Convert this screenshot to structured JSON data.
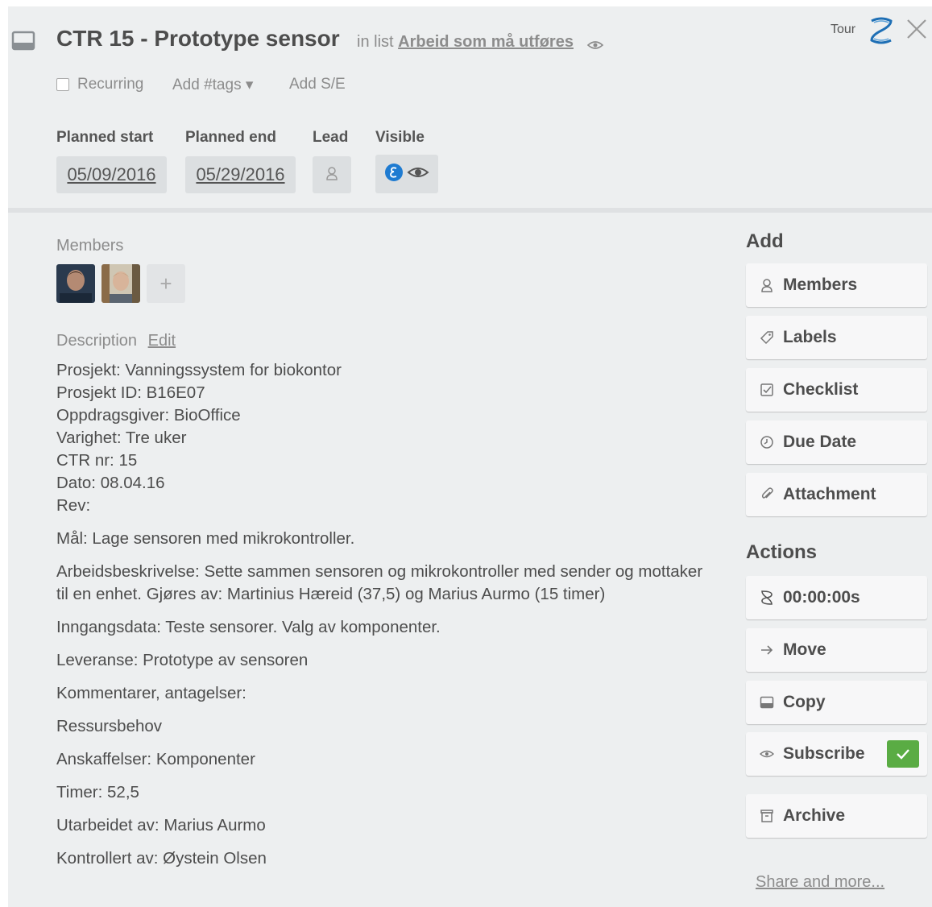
{
  "card": {
    "title": "CTR 15 - Prototype sensor",
    "in_list_prefix": "in list",
    "list_name": "Arbeid som må utføres",
    "tour_label": "Tour"
  },
  "options": {
    "recurring_label": "Recurring",
    "recurring_checked": false,
    "add_tags_label": "Add #tags ▾",
    "add_se_label": "Add S/E"
  },
  "fields": {
    "planned_start_label": "Planned start",
    "planned_start_value": "05/09/2016",
    "planned_end_label": "Planned end",
    "planned_end_value": "05/29/2016",
    "lead_label": "Lead",
    "visible_label": "Visible"
  },
  "members": {
    "label": "Members",
    "add_glyph": "+",
    "count": 2
  },
  "description": {
    "label": "Description",
    "edit_label": "Edit",
    "header_lines": [
      "Prosjekt: Vanningssystem for biokontor",
      "Prosjekt ID: B16E07",
      "Oppdragsgiver: BioOffice",
      "Varighet: Tre uker",
      "CTR nr: 15",
      "Dato: 08.04.16",
      "Rev:"
    ],
    "paragraphs": [
      "Mål: Lage sensoren med mikrokontroller.",
      "Arbeidsbeskrivelse: Sette sammen sensoren og mikrokontroller med sender og mottaker til en enhet. Gjøres av: Martinius Hæreid (37,5) og Marius Aurmo (15 timer)",
      "Inngangsdata: Teste sensorer. Valg av komponenter.",
      "Leveranse: Prototype av sensoren",
      "Kommentarer, antagelser:",
      "Ressursbehov",
      "Anskaffelser: Komponenter",
      "Timer: 52,5",
      "Utarbeidet av: Marius Aurmo",
      "Kontrollert av: Øystein Olsen"
    ]
  },
  "sidebar": {
    "add_heading": "Add",
    "add_buttons": [
      {
        "label": "Members",
        "icon": "person-icon"
      },
      {
        "label": "Labels",
        "icon": "tag-icon"
      },
      {
        "label": "Checklist",
        "icon": "checklist-icon"
      },
      {
        "label": "Due Date",
        "icon": "clock-icon"
      },
      {
        "label": "Attachment",
        "icon": "paperclip-icon"
      }
    ],
    "actions_heading": "Actions",
    "timer_label": "00:00:00s",
    "move_label": "Move",
    "copy_label": "Copy",
    "subscribe_label": "Subscribe",
    "subscribed": true,
    "archive_label": "Archive",
    "share_label": "Share and more..."
  },
  "colors": {
    "background": "#edeff0",
    "field_box": "#dcdfe1",
    "subscribe_check": "#5aac44",
    "tour_blue": "#1e6fb5",
    "visible_badge": "#1e7bd1"
  }
}
